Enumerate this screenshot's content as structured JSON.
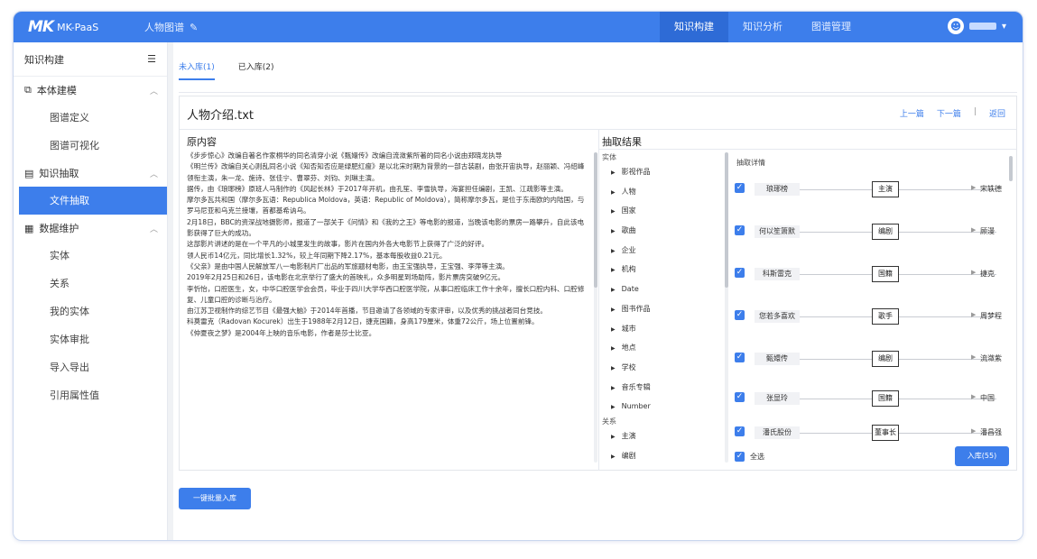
{
  "app": {
    "logo_mark": "MK",
    "logo_text": "MK-PaaS",
    "project": "人物图谱",
    "project_edit_icon": "edit-icon"
  },
  "nav": {
    "items": [
      "知识构建",
      "知识分析",
      "图谱管理"
    ],
    "active": "知识构建"
  },
  "sidebar": {
    "title": "知识构建",
    "groups": [
      {
        "label": "本体建模",
        "icon": "ontology-icon",
        "items": [
          "图谱定义",
          "图谱可视化"
        ]
      },
      {
        "label": "知识抽取",
        "icon": "extract-icon",
        "items": [
          "文件抽取"
        ]
      },
      {
        "label": "数据维护",
        "icon": "maintain-icon",
        "items": [
          "实体",
          "关系",
          "我的实体",
          "实体审批",
          "导入导出",
          "引用属性值"
        ]
      }
    ],
    "active_item": "文件抽取"
  },
  "tabs": [
    "未入库(1)",
    "已入库(2)"
  ],
  "card": {
    "title": "人物介绍.txt",
    "prev": "上一篇",
    "next": "下一篇",
    "back": "返回",
    "sep": "|"
  },
  "original": {
    "title": "原内容",
    "paragraphs": [
      "《步步惊心》改编自著名作家桐华的同名清穿小说《甄嬛传》改编自流潋紫所著的同名小说由郑晓龙执导",
      "《明兰传》改编自关心则乱同名小说《知否知否应是绿肥红瘦》是以北宋时期为背景的一部古装剧，由张开宙执导，赵丽颖、冯绍峰领衔主演，朱一龙、施诗、张佳宁、曹翠芬、刘钧、刘琳主演。",
      "据传，由《琅琊榜》原班人马制作的《风起长林》于2017年开机，由孔笙、李雪执导，海宴担任编剧，王凯、江疏影等主演。",
      "摩尔多瓦共和国（摩尔多瓦语：Republica Moldova，英语：Republic of Moldova），简称摩尔多瓦，是位于东南欧的内陆国，与罗马尼亚和乌克兰接壤，首都基希讷乌。",
      "2月18日，BBC的资深战地摄影师，报道了一部关于《问情》和《我的之王》等电影的报道，当晚该电影的票房一路攀升，自此该电影获得了巨大的成功。",
      "这部影片讲述的是在一个平凡的小城里发生的故事，影片在国内外各大电影节上获得了广泛的好评。",
      "领人民币14亿元，同比增长1.32%，较上年同期下降2.17%，基本每股收益0.21元。",
      "《父亲》是由中国人民解放军八一电影制片厂出品的军旅题材电影，由王宝强执导，王宝强、李萍等主演。",
      "2019年2月25日和26日，该电影在北京举行了盛大的首映礼，众多明星到场助阵，影片票房突破9亿元。",
      "李忻怡，口腔医生，女，中华口腔医学会会员，毕业于四川大学华西口腔医学院，从事口腔临床工作十余年，擅长口腔内科、口腔修复、儿童口腔的诊断与治疗。",
      "由江苏卫视制作的综艺节目《最强大脑》于2014年首播，节目邀请了各领域的专家评审，以及优秀的挑战者同台竞技。",
      "科莫雷克（Radovan Kocurek）出生于1988年2月12日，捷克国籍，身高179厘米，体重72公斤，场上位置前锋。",
      "《仲夏夜之梦》是2004年上映的音乐电影，作者是莎士比亚。"
    ]
  },
  "results": {
    "title": "抽取结果",
    "entity_group": "实体",
    "entities": [
      "影视作品",
      "人物",
      "国家",
      "歌曲",
      "企业",
      "机构",
      "Date",
      "图书作品",
      "城市",
      "地点",
      "学校",
      "音乐专辑",
      "Number"
    ],
    "relation_group": "关系",
    "relations": [
      "主演",
      "编剧"
    ]
  },
  "detail": {
    "title": "抽取详情",
    "rows": [
      {
        "subject": "琅琊榜",
        "relation": "主演",
        "object": "宋轶德"
      },
      {
        "subject": "何以笙箫默",
        "relation": "编剧",
        "object": "顾漫"
      },
      {
        "subject": "科斯雷克",
        "relation": "国籍",
        "object": "捷克"
      },
      {
        "subject": "您若多喜欢",
        "relation": "歌手",
        "object": "周梦程"
      },
      {
        "subject": "甄嬛传",
        "relation": "编剧",
        "object": "流潋紫"
      },
      {
        "subject": "张显玲",
        "relation": "国籍",
        "object": "中国"
      },
      {
        "subject": "潘氏股份",
        "relation": "董事长",
        "object": "潘昌强"
      }
    ],
    "select_all": "全选",
    "import_label": "入库(55)"
  },
  "bottom_button": "一键批量入库"
}
